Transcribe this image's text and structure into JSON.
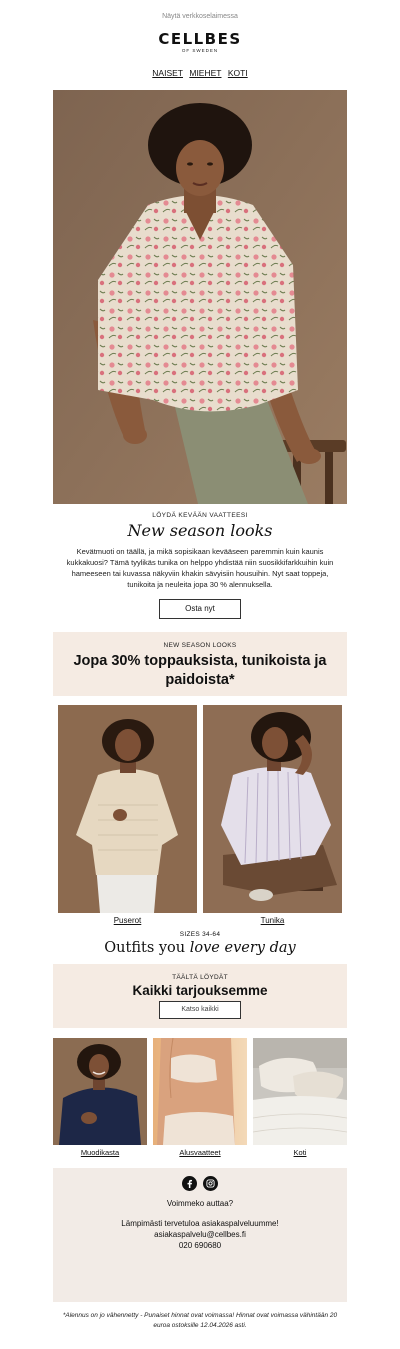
{
  "preheader": "Näytä verkkoselaimessa",
  "brand": {
    "name": "CELLBES",
    "tagline": "OF SWEDEN"
  },
  "nav": [
    {
      "label": "NAISET"
    },
    {
      "label": "MIEHET"
    },
    {
      "label": "KOTI"
    }
  ],
  "intro": {
    "eyebrow": "LÖYDÄ KEVÄÄN VAATTEESI",
    "title": "New season looks",
    "text": "Kevätmuoti on täällä, ja mikä sopisikaan kevääseen paremmin kuin kaunis kukkakuosi? Tämä tyylikäs tunika on helppo yhdistää niin suosikkifarkkuihin kuin hameeseen tai kuvassa näkyviin khakin sävyisiin housuihin. Nyt saat toppeja, tunikoita ja neuleita jopa 30 % alennuksella.",
    "button": "Osta nyt"
  },
  "promo": {
    "eyebrow": "NEW SEASON LOOKS",
    "title": "Jopa 30% toppauksista, tunikoista ja paidoista*"
  },
  "duo": [
    {
      "label": "Puserot"
    },
    {
      "label": "Tunika"
    }
  ],
  "sizes": {
    "eyebrow": "SIZES 34-64",
    "title_plain": "Outfits you ",
    "title_italic": "love every day"
  },
  "offers": {
    "eyebrow": "TÄÄLTÄ LÖYDÄT",
    "title": "Kaikki tarjouksemme",
    "button": "Katso kaikki"
  },
  "trio": [
    {
      "label": "Muodikasta"
    },
    {
      "label": "Alusvaatteet"
    },
    {
      "label": "Koti"
    }
  ],
  "footer": {
    "help": "Voimmeko auttaa?",
    "welcome": "Lämpimästi tervetuloa asiakaspalveluumme!",
    "email": "asiakaspalvelu@cellbes.fi",
    "phone": "020 690680",
    "social": [
      "facebook-icon",
      "instagram-icon"
    ]
  },
  "disclaimer": "*Alennus on jo vähennetty - Punaiset hinnat ovat voimassa! Hinnat ovat voimassa vähintään 20 euroa ostoksille 12.04.2026 asti.",
  "colors": {
    "promo_bg": "#f5ebe3",
    "footer_bg": "#f2ebe6",
    "hero_bg": "#8a6e55"
  }
}
